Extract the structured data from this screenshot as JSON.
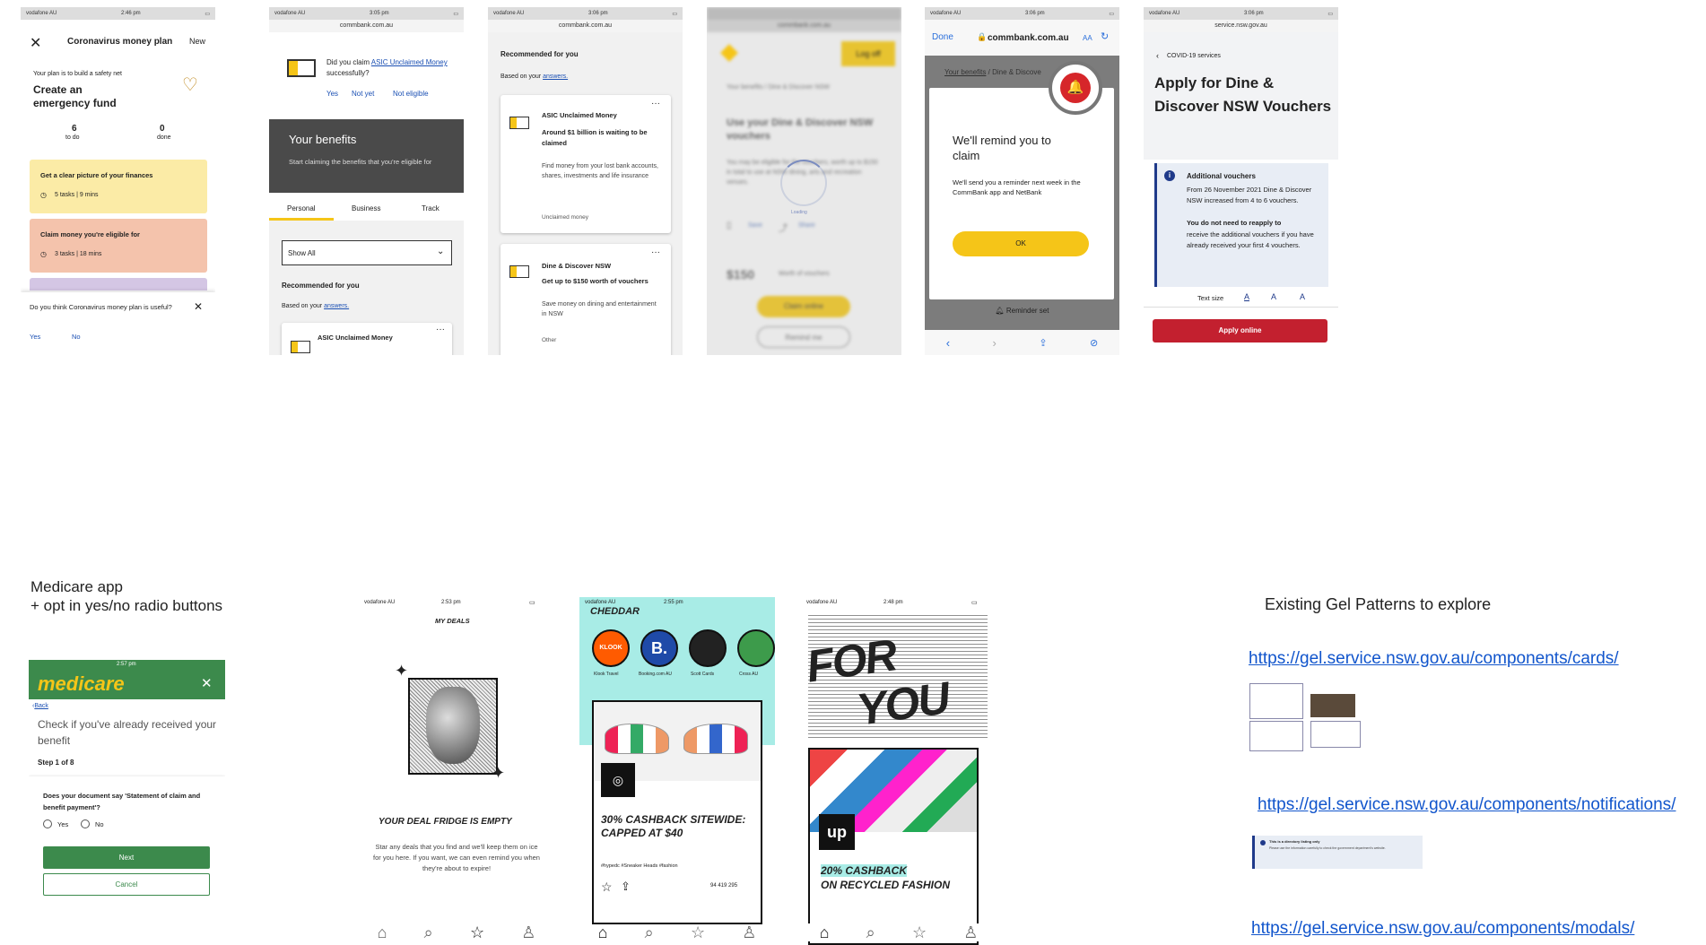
{
  "s1": {
    "status_time": "2:46 pm",
    "title": "Coronavirus money plan",
    "new_label": "New",
    "subtitle": "Your plan is to build a safety net",
    "heading": "Create an emergency fund",
    "todo_count": "6",
    "todo_label": "to do",
    "done_count": "0",
    "done_label": "done",
    "card1_title": "Get a clear picture of your finances",
    "card1_meta": "5 tasks | 9 mins",
    "card2_title": "Claim money you're eligible for",
    "card2_meta": "3 tasks | 18 mins",
    "feedback_q": "Do you think Coronavirus money plan is useful?",
    "yes": "Yes",
    "no": "No",
    "colors": {
      "card1": "#fbeba6",
      "card2": "#f4c3ac",
      "card3": "#d4c6e4"
    }
  },
  "s2": {
    "status_time": "3:05 pm",
    "url": "commbank.com.au",
    "claim_q_pre": "Did you claim ",
    "claim_link": "ASIC Unclaimed Money",
    "claim_q_post": " successfully?",
    "opt_yes": "Yes",
    "opt_notyet": "Not yet",
    "opt_noteligible": "Not eligible",
    "benefits_title": "Your benefits",
    "benefits_sub": "Start claiming the benefits that you're eligible for",
    "tab_personal": "Personal",
    "tab_business": "Business",
    "tab_track": "Track",
    "filter": "Show All",
    "rec_title": "Recommended for you",
    "rec_sub_pre": "Based on your ",
    "rec_sub_link": "answers.",
    "item_title": "ASIC Unclaimed Money"
  },
  "s3": {
    "status_time": "3:06 pm",
    "url": "commbank.com.au",
    "rec_title": "Recommended for you",
    "rec_sub_pre": "Based on your ",
    "rec_sub_link": "answers.",
    "c1_title": "ASIC Unclaimed Money",
    "c1_bold": "Around $1 billion is waiting to be claimed",
    "c1_text": "Find money from your lost bank accounts, shares, investments and life insurance",
    "c1_tag": "Unclaimed money",
    "c2_title": "Dine & Discover NSW",
    "c2_bold": "Get up to $150 worth of vouchers",
    "c2_text": "Save money on dining and entertainment in NSW",
    "c2_tag": "Other"
  },
  "s4": {
    "url": "commbank.com.au",
    "login": "Log off",
    "crumb": "Your benefits / Dine & Discover NSW",
    "heading": "Use your Dine & Discover NSW vouchers",
    "body": "You may be eligible for the vouchers, worth up to $150 in total to use at NSW dining, arts and recreation venues.",
    "save": "Save",
    "share": "Share",
    "amount": "$150",
    "amount_label": "Worth of vouchers",
    "claim_btn": "Claim online",
    "remind_btn": "Remind me",
    "loading": "Loading"
  },
  "s5": {
    "status_time": "3:06 pm",
    "done": "Done",
    "url": "commbank.com.au",
    "aa": "AA",
    "crumb_link": "Your benefits",
    "crumb_rest": " / Dine & Discove",
    "modal_title": "We'll remind you to claim",
    "modal_body": "We'll send you a reminder next week in the CommBank app and NetBank",
    "ok": "OK",
    "reminder_set": "Reminder set"
  },
  "s6": {
    "status_time": "3:06 pm",
    "url": "service.nsw.gov.au",
    "back": "COVID-19 services",
    "heading": "Apply for Dine & Discover NSW Vouchers",
    "info_title": "Additional vouchers",
    "info_body": "From 26 November 2021 Dine & Discover NSW increased from 4 to 6 vouchers.",
    "info_bold": "You do not need to reapply to",
    "info_rest": "receive the additional vouchers if you have already received your first 4 vouchers.",
    "text_size": "Text size",
    "a1": "A",
    "a2": "A",
    "a3": "A",
    "apply": "Apply online"
  },
  "medicare": {
    "label_line1": "Medicare app",
    "label_line2": "+ opt in yes/no radio buttons",
    "status_time": "2:57 pm",
    "logo": "medicare",
    "back": "Back",
    "heading": "Check if you've already received your benefit",
    "step": "Step 1 of 8",
    "question": "Does your document say 'Statement of claim and benefit payment'?",
    "yes": "Yes",
    "no": "No",
    "next": "Next",
    "cancel": "Cancel"
  },
  "up1": {
    "status_time": "2:53 pm",
    "title": "MY DEALS",
    "empty_title": "YOUR DEAL FRIDGE IS EMPTY",
    "empty_body": "Star any deals that you find and we'll keep them on ice for you here. If you want, we can even remind you when they're about to expire!"
  },
  "up2": {
    "status_time": "2:55 pm",
    "brand": "CHEDDAR",
    "cats": [
      "Klook Travel",
      "Booking.com AU",
      "Scott Cards",
      "Cross AU"
    ],
    "deal_title": "30% CASHBACK SITEWIDE: CAPPED AT $40",
    "tags": "#hypedc #Sneaker Heads #fashion",
    "count": "94 419 295"
  },
  "up3": {
    "status_time": "2:48 pm",
    "hero_line1": "FOR",
    "hero_line2": "YOU",
    "logo": "up",
    "deal_title1": "20% CASHBACK",
    "deal_title2": "ON RECYCLED FASHION"
  },
  "gel": {
    "title": "Existing Gel Patterns to explore",
    "link_cards": "https://gel.service.nsw.gov.au/components/cards/",
    "link_notifications": "https://gel.service.nsw.gov.au/components/notifications/",
    "link_modals": "https://gel.service.nsw.gov.au/components/modals/",
    "thumb_notif_title": "This is a directory listing only",
    "thumb_notif_body": "Please use the information carefully to check the government department's website."
  }
}
